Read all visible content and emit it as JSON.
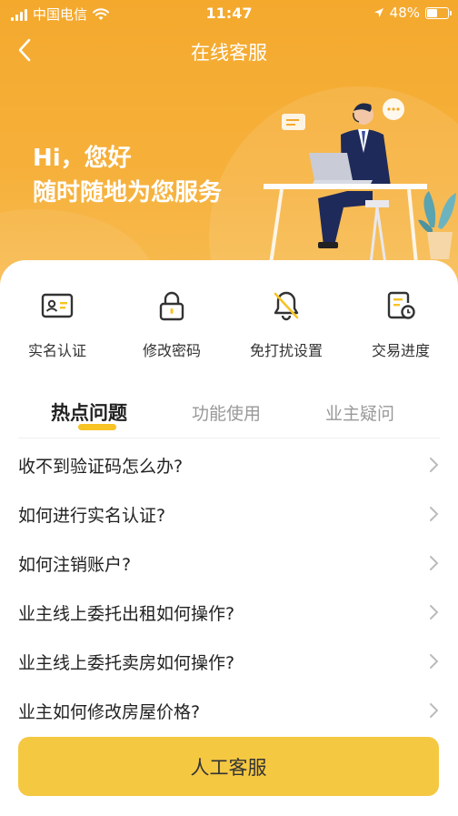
{
  "status_bar": {
    "carrier": "中国电信",
    "time": "11:47",
    "battery": "48%",
    "battery_level": 0.48
  },
  "header": {
    "title": "在线客服"
  },
  "greeting": {
    "line1": "Hi，您好",
    "line2": "随时随地为您服务"
  },
  "quick_actions": [
    {
      "label": "实名认证",
      "icon": "id-card-icon"
    },
    {
      "label": "修改密码",
      "icon": "lock-icon"
    },
    {
      "label": "免打扰设置",
      "icon": "bell-off-icon"
    },
    {
      "label": "交易进度",
      "icon": "document-progress-icon"
    }
  ],
  "tabs": [
    {
      "label": "热点问题",
      "active": true
    },
    {
      "label": "功能使用",
      "active": false
    },
    {
      "label": "业主疑问",
      "active": false
    }
  ],
  "faq": [
    "收不到验证码怎么办?",
    "如何进行实名认证?",
    "如何注销账户?",
    "业主线上委托出租如何操作?",
    "业主线上委托卖房如何操作?",
    "业主如何修改房屋价格?"
  ],
  "cta": {
    "label": "人工客服"
  },
  "colors": {
    "hero": "#f4a92d",
    "accent": "#f7c325",
    "button": "#f5c842"
  }
}
